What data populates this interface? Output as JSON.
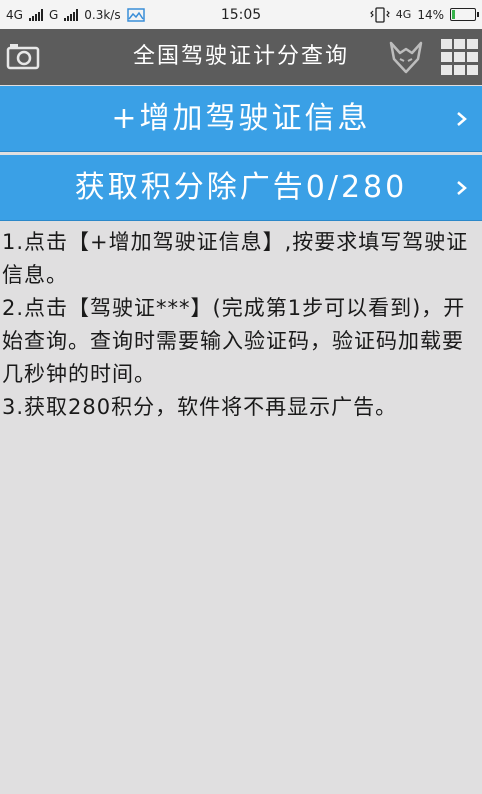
{
  "status_bar": {
    "network_left": "4G",
    "network_mid": "G",
    "speed": "0.3k/s",
    "time": "15:05",
    "network_right": "4G",
    "battery_text": "14%",
    "battery_level": 0.14
  },
  "header": {
    "title": "全国驾驶证计分查询",
    "left_icon": "camera-icon",
    "right_icons": [
      "wolf-logo-icon",
      "grid-menu-icon"
    ]
  },
  "buttons": {
    "add_license": "+增加驾驶证信息",
    "get_points": "获取积分除广告0/280"
  },
  "instructions": [
    "1.点击【+增加驾驶证信息】,按要求填写驾驶证信息。",
    "2.点击【驾驶证***】(完成第1步可以看到)，开始查询。查询时需要输入验证码，验证码加载要几秒钟的时间。",
    "3.获取280积分，软件将不再显示广告。"
  ],
  "colors": {
    "title_bar": "#5c5c5c",
    "button_blue": "#3aa0e6",
    "background": "#e0dfe0"
  }
}
